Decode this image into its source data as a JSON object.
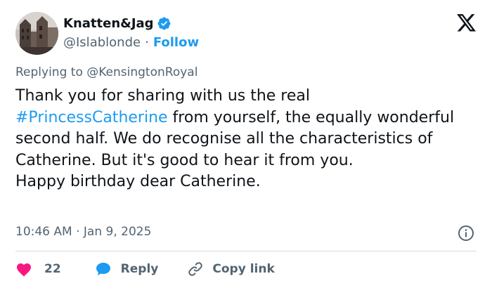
{
  "tweet": {
    "author_name": "Knatten&Jag",
    "handle": "@Islablonde",
    "separator": "·",
    "follow_label": "Follow",
    "replying_to": "Replying to @KensingtonRoyal",
    "text_line1": "Thank you for sharing with us the real\n",
    "hashtag": "#PrincessCatherine",
    "text_rest": " from yourself, the equally wonderful second half. We do recognise all the characteristics of Catherine. But it's good to hear it from you.\nHappy birthday dear Catherine.",
    "timestamp": "10:46 AM · Jan 9, 2025"
  },
  "actions": {
    "likes_count": "22",
    "reply_label": "Reply",
    "copy_link_label": "Copy link"
  },
  "colors": {
    "accent": "#1d9bf0",
    "like": "#f91880",
    "secondary_text": "#536471",
    "divider": "#cfd9de"
  },
  "icons": [
    "verified-badge-icon",
    "x-logo-icon",
    "info-icon",
    "heart-icon",
    "reply-bubble-icon",
    "link-icon"
  ]
}
